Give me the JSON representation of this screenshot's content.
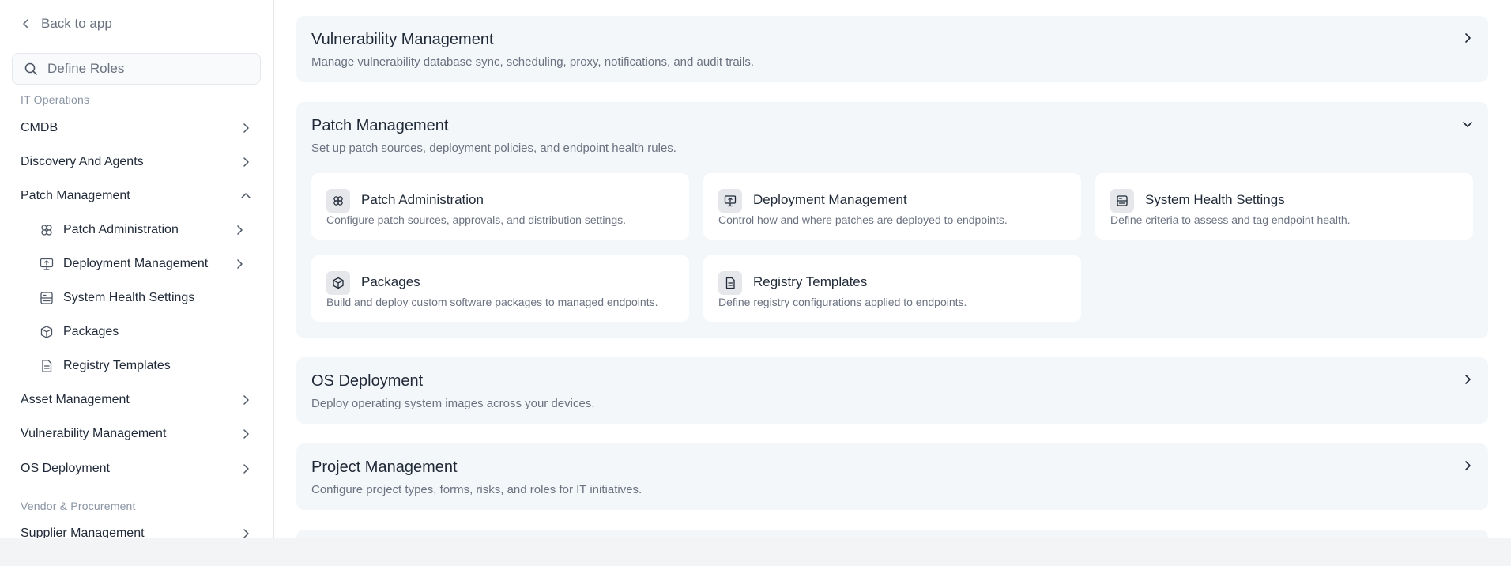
{
  "sidebar": {
    "back_label": "Back to app",
    "search_placeholder": "Define Roles",
    "group_it": "IT Operations",
    "group_vendor": "Vendor & Procurement",
    "items": {
      "cmdb": "CMDB",
      "discovery": "Discovery And Agents",
      "patch": "Patch Management",
      "asset": "Asset Management",
      "vuln": "Vulnerability Management",
      "os": "OS Deployment",
      "supplier": "Supplier Management"
    },
    "patch_children": {
      "admin": "Patch Administration",
      "deploy": "Deployment Management",
      "health": "System Health Settings",
      "packages": "Packages",
      "registry": "Registry Templates"
    }
  },
  "main": {
    "vuln": {
      "title": "Vulnerability Management",
      "desc": "Manage vulnerability database sync, scheduling, proxy, notifications, and audit trails."
    },
    "patch": {
      "title": "Patch Management",
      "desc": "Set up patch sources, deployment policies, and endpoint health rules.",
      "cards": {
        "admin": {
          "title": "Patch Administration",
          "desc": "Configure patch sources, approvals, and distribution settings."
        },
        "deploy": {
          "title": "Deployment Management",
          "desc": "Control how and where patches are deployed to endpoints."
        },
        "health": {
          "title": "System Health Settings",
          "desc": "Define criteria to assess and tag endpoint health."
        },
        "packages": {
          "title": "Packages",
          "desc": "Build and deploy custom software packages to managed endpoints."
        },
        "registry": {
          "title": "Registry Templates",
          "desc": "Define registry configurations applied to endpoints."
        }
      }
    },
    "os": {
      "title": "OS Deployment",
      "desc": "Deploy operating system images across your devices."
    },
    "project": {
      "title": "Project Management",
      "desc": "Configure project types, forms, risks, and roles for IT initiatives."
    }
  }
}
